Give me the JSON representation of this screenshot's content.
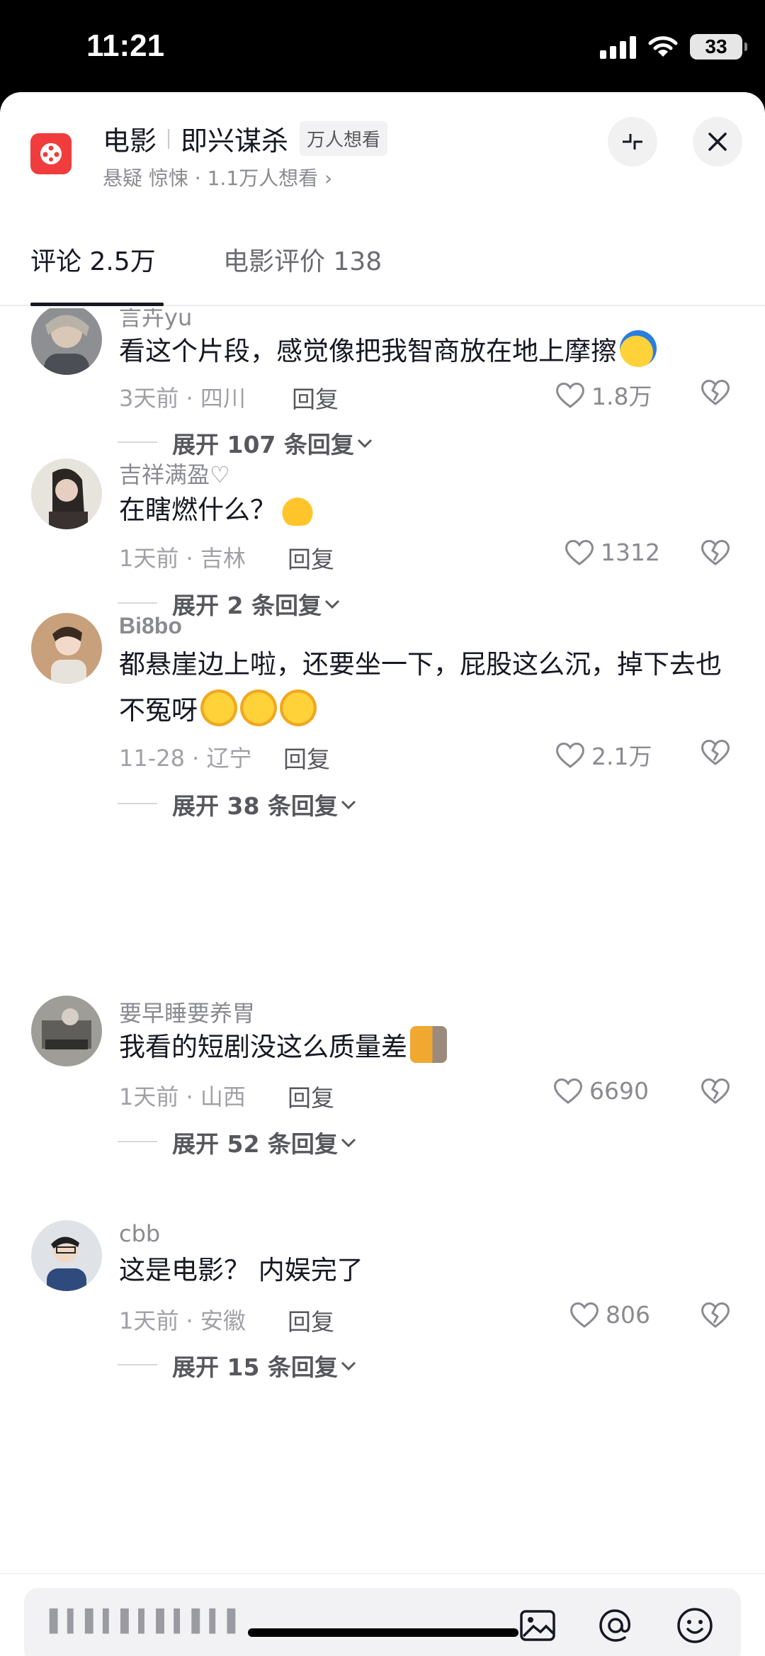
{
  "status": {
    "time": "11:21",
    "battery": "33"
  },
  "header": {
    "category": "电影",
    "title": "即兴谋杀",
    "badge": "万人想看",
    "subtitle": "悬疑 惊悚 · 1.1万人想看 ›"
  },
  "tabs": [
    {
      "label": "评论 2.5万"
    },
    {
      "label": "电影评价 138"
    }
  ],
  "comments": [
    {
      "user": "言卉yu",
      "text": "看这个片段，感觉像把我智商放在地上摩擦",
      "meta": "3天前 · 四川",
      "reply": "回复",
      "likes": "1.8万",
      "expand": "展开 107 条回复"
    },
    {
      "user": "吉祥满盈♡",
      "text": "在瞎燃什么？",
      "meta": "1天前 · 吉林",
      "reply": "回复",
      "likes": "1312",
      "expand": "展开 2 条回复"
    },
    {
      "user": "Bi8bo",
      "text": "都悬崖边上啦，还要坐一下，屁股这么沉，掉下去也不冤呀",
      "meta": "11-28 · 辽宁",
      "reply": "回复",
      "likes": "2.1万",
      "expand": "展开 38 条回复"
    },
    {
      "user": "要早睡要养胃",
      "text": "我看的短剧没这么质量差",
      "meta": "1天前 · 山西",
      "reply": "回复",
      "likes": "6690",
      "expand": "展开 52 条回复"
    },
    {
      "user": "cbb",
      "text": "这是电影？ 内娱完了",
      "meta": "1天前 · 安徽",
      "reply": "回复",
      "likes": "806",
      "expand": "展开 15 条回复"
    }
  ],
  "input": {
    "placeholder": "▌▍▌▍▌▍▌▍▌▍▌"
  },
  "colors": {
    "accent": "#f03c3c",
    "text": "#161823",
    "muted": "#8a8b91"
  }
}
